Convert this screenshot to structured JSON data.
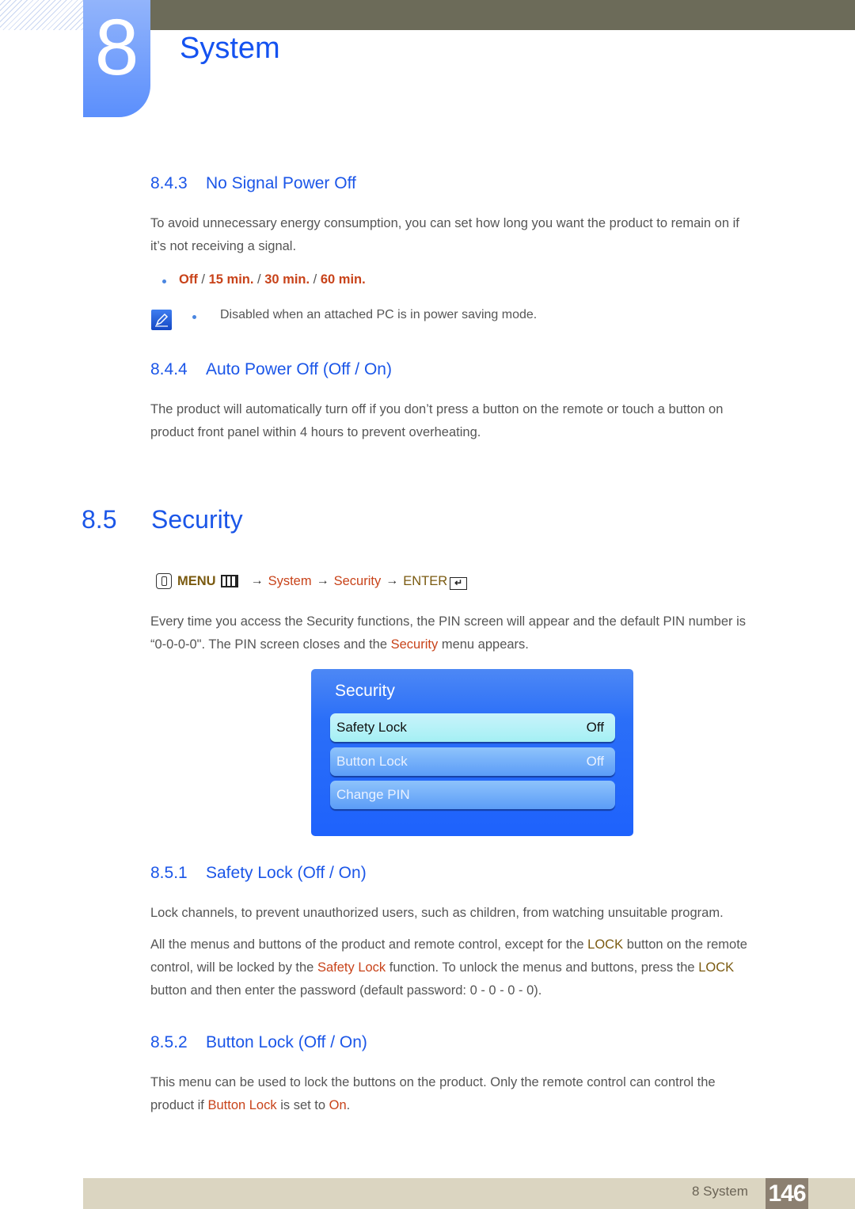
{
  "chapter": {
    "number": "8",
    "title": "System"
  },
  "sections": {
    "s843": {
      "num": "8.4.3",
      "title": "No Signal Power Off",
      "body_line1": "To avoid unnecessary energy consumption, you can set how long you want the product to remain on if",
      "body_line2": "it’s not receiving a signal.",
      "options": [
        "Off",
        "15 min.",
        "30 min.",
        "60 min."
      ],
      "separator": " / ",
      "note": "Disabled when an attached PC is in power saving mode."
    },
    "s844": {
      "num": "8.4.4",
      "title": "Auto Power Off (Off / On)",
      "body_line1": "The product will automatically turn off if you don’t press a button on the remote or touch a button on",
      "body_line2": "product front panel within 4 hours to prevent overheating."
    },
    "s85": {
      "num": "8.5",
      "title": "Security",
      "menu_path": {
        "menu": "MENU",
        "arrow": "→",
        "system": "System",
        "security": "Security",
        "enter": "ENTER"
      },
      "body_line1": "Every time you access the Security functions, the PIN screen will appear and the default PIN number is",
      "body_line2_a": "“0-0-0-0\". The PIN screen closes and the ",
      "body_line2_hl": "Security",
      "body_line2_b": " menu appears."
    },
    "s851": {
      "num": "8.5.1",
      "title": "Safety Lock (Off / On)",
      "p1": "Lock channels, to prevent unauthorized users, such as children, from watching unsuitable program.",
      "p2_l1_a": "All the menus and buttons of the product and remote control, except for the ",
      "p2_l1_hl": "LOCK",
      "p2_l1_b": " button on the remote",
      "p2_l2_a": "control, will be locked by the ",
      "p2_l2_hl1": "Safety Lock",
      "p2_l2_b": " function. To unlock the menus and buttons, press the ",
      "p2_l2_hl2": "LOCK",
      "p2_l3": "button and then enter the password (default password: 0 - 0 - 0 - 0)."
    },
    "s852": {
      "num": "8.5.2",
      "title": "Button Lock (Off / On)",
      "l1": "This menu can be used to lock the buttons on the product. Only the remote control can control the",
      "l2_a": "product if ",
      "l2_hl1": "Button Lock",
      "l2_b": " is set to ",
      "l2_hl2": "On",
      "l2_c": "."
    }
  },
  "osd": {
    "title": "Security",
    "items": [
      {
        "label": "Safety Lock",
        "value": "Off",
        "selected": true
      },
      {
        "label": "Button Lock",
        "value": "Off",
        "selected": false
      },
      {
        "label": "Change PIN",
        "value": "",
        "selected": false
      }
    ]
  },
  "footer": {
    "label": "8 System",
    "page": "146"
  },
  "colors": {
    "heading": "#1b56e8",
    "highlight": "#c8431a",
    "gold": "#7a5a10",
    "osd_bg": "#1e62fc",
    "footer": "#dbd5c1"
  }
}
